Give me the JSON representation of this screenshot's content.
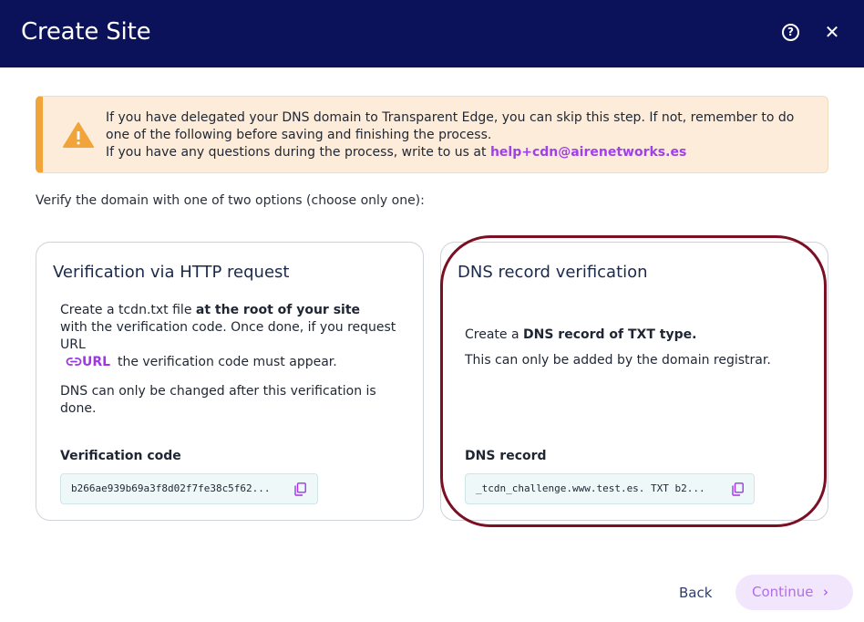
{
  "header": {
    "title": "Create Site",
    "help_icon": "question-circle-icon",
    "close_icon": "close-icon",
    "close_glyph": "✕",
    "help_glyph": "?"
  },
  "alert": {
    "icon": "warning-triangle-icon",
    "line1": "If you have delegated your DNS domain to Transparent Edge, you can skip this step. If not, remember to do",
    "line2": "one of the following before saving and finishing the process.",
    "line3_prefix": "If you have any questions during the process, write to us at",
    "email": "help+cdn@airenetworks.es",
    "accent_color": "#f0a43a",
    "background_color": "#fcecd9"
  },
  "intro": "Verify the domain with one of two options (choose only one):",
  "http_card": {
    "title": "Verification via HTTP request",
    "line1_prefix": "Create a tcdn.txt file",
    "line1_bold": "at the root of your site",
    "line2": "with the verification code. Once done, if you request",
    "line3": "URL",
    "url_link": "URL",
    "line4_suffix": "the verification code must appear.",
    "note_line1": "DNS can only be changed after this verification is",
    "note_line2": "done.",
    "code_label": "Verification code",
    "code_value": "b266ae939b69a3f8d02f7fe38c5f62...",
    "copy_icon": "copy-icon"
  },
  "dns_card": {
    "title": "DNS record verification",
    "line1_prefix": "Create a",
    "line1_bold": "DNS record of TXT type.",
    "line2": "This can only be added by the domain registrar.",
    "code_label": "DNS record",
    "code_value": "_tcdn_challenge.www.test.es. TXT b2...",
    "copy_icon": "copy-icon",
    "highlight_color": "#7b0f24"
  },
  "footer": {
    "back_label": "Back",
    "continue_label": "Continue",
    "continue_icon": "chevron-right-icon",
    "continue_glyph": "›"
  },
  "colors": {
    "header_bg": "#0c1259",
    "link": "#a040e8",
    "code_bg": "#eef8f8"
  }
}
